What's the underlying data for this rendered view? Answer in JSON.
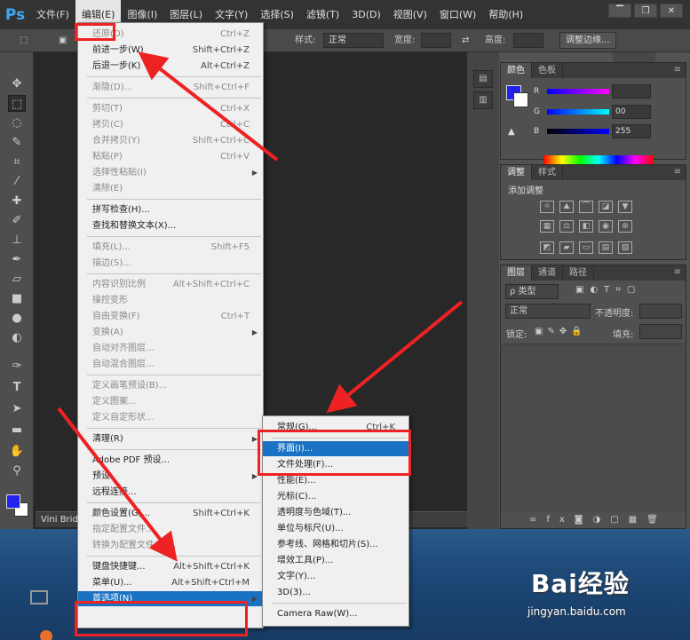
{
  "app": {
    "logo": "Ps",
    "menus": [
      "文件(F)",
      "编辑(E)",
      "图像(I)",
      "图层(L)",
      "文字(Y)",
      "选择(S)",
      "滤镜(T)",
      "3D(D)",
      "视图(V)",
      "窗口(W)",
      "帮助(H)"
    ],
    "window_controls": [
      "▔",
      "❐",
      "✕"
    ]
  },
  "options": {
    "style_label": "样式:",
    "style_value": "正常",
    "width_label": "宽度:",
    "height_label": "高度:",
    "adjust_edge": "调整边缘..."
  },
  "doc_tab": "Vini Bridg",
  "color_panel": {
    "tabs": [
      "颜色",
      "色板"
    ],
    "r": "R",
    "g": "G",
    "b": "B",
    "g_value": "00",
    "b_value": "255"
  },
  "adjust_panel": {
    "tabs": [
      "调整",
      "样式"
    ],
    "title": "添加调整"
  },
  "layers_panel": {
    "tabs": [
      "图层",
      "通道",
      "路径"
    ],
    "kind": "ρ 类型",
    "blend": "正常",
    "opacity": "不透明度:",
    "lock": "锁定:",
    "fill": "填充:"
  },
  "edit_menu": [
    {
      "label": "还原(O)",
      "shortcut": "Ctrl+Z",
      "disabled": true
    },
    {
      "label": "前进一步(W)",
      "shortcut": "Shift+Ctrl+Z"
    },
    {
      "label": "后退一步(K)",
      "shortcut": "Alt+Ctrl+Z"
    },
    {
      "sep": true
    },
    {
      "label": "渐隐(D)...",
      "shortcut": "Shift+Ctrl+F",
      "disabled": true
    },
    {
      "sep": true
    },
    {
      "label": "剪切(T)",
      "shortcut": "Ctrl+X",
      "disabled": true
    },
    {
      "label": "拷贝(C)",
      "shortcut": "Ctrl+C",
      "disabled": true
    },
    {
      "label": "合并拷贝(Y)",
      "shortcut": "Shift+Ctrl+C",
      "disabled": true
    },
    {
      "label": "粘贴(P)",
      "shortcut": "Ctrl+V",
      "disabled": true
    },
    {
      "label": "选择性粘贴(I)",
      "submenu": true,
      "disabled": true
    },
    {
      "label": "清除(E)",
      "disabled": true
    },
    {
      "sep": true
    },
    {
      "label": "拼写检查(H)..."
    },
    {
      "label": "查找和替换文本(X)..."
    },
    {
      "sep": true
    },
    {
      "label": "填充(L)...",
      "shortcut": "Shift+F5",
      "disabled": true
    },
    {
      "label": "描边(S)...",
      "disabled": true
    },
    {
      "sep": true
    },
    {
      "label": "内容识别比例",
      "shortcut": "Alt+Shift+Ctrl+C",
      "disabled": true
    },
    {
      "label": "操控变形",
      "disabled": true
    },
    {
      "label": "自由变换(F)",
      "shortcut": "Ctrl+T",
      "disabled": true
    },
    {
      "label": "变换(A)",
      "submenu": true,
      "disabled": true
    },
    {
      "label": "自动对齐图层...",
      "disabled": true
    },
    {
      "label": "自动混合图层...",
      "disabled": true
    },
    {
      "sep": true
    },
    {
      "label": "定义画笔预设(B)...",
      "disabled": true
    },
    {
      "label": "定义图案...",
      "disabled": true
    },
    {
      "label": "定义自定形状...",
      "disabled": true
    },
    {
      "sep": true
    },
    {
      "label": "清理(R)",
      "submenu": true
    },
    {
      "sep": true
    },
    {
      "label": "Adobe PDF 预设..."
    },
    {
      "label": "预设",
      "submenu": true
    },
    {
      "label": "远程连接..."
    },
    {
      "sep": true
    },
    {
      "label": "颜色设置(G)...",
      "shortcut": "Shift+Ctrl+K"
    },
    {
      "label": "指定配置文件...",
      "disabled": true
    },
    {
      "label": "转换为配置文件(V)...",
      "disabled": true
    },
    {
      "sep": true
    },
    {
      "label": "键盘快捷键...",
      "shortcut": "Alt+Shift+Ctrl+K"
    },
    {
      "label": "菜单(U)...",
      "shortcut": "Alt+Shift+Ctrl+M"
    },
    {
      "label": "首选项(N)",
      "submenu": true,
      "highlighted": true
    }
  ],
  "prefs_menu": [
    {
      "label": "常规(G)...",
      "shortcut": "Ctrl+K"
    },
    {
      "sep": true
    },
    {
      "label": "界面(I)...",
      "highlighted": true
    },
    {
      "label": "文件处理(F)..."
    },
    {
      "label": "性能(E)..."
    },
    {
      "label": "光标(C)..."
    },
    {
      "label": "透明度与色域(T)..."
    },
    {
      "label": "单位与标尺(U)..."
    },
    {
      "label": "参考线、网格和切片(S)..."
    },
    {
      "label": "增效工具(P)..."
    },
    {
      "label": "文字(Y)..."
    },
    {
      "label": "3D(3)..."
    },
    {
      "sep": true
    },
    {
      "label": "Camera Raw(W)..."
    }
  ],
  "watermark": {
    "brand": "Bai经验",
    "url": "jingyan.baidu.com"
  },
  "colors": {
    "accent": "#1a72c4",
    "annotation": "#e22222"
  }
}
